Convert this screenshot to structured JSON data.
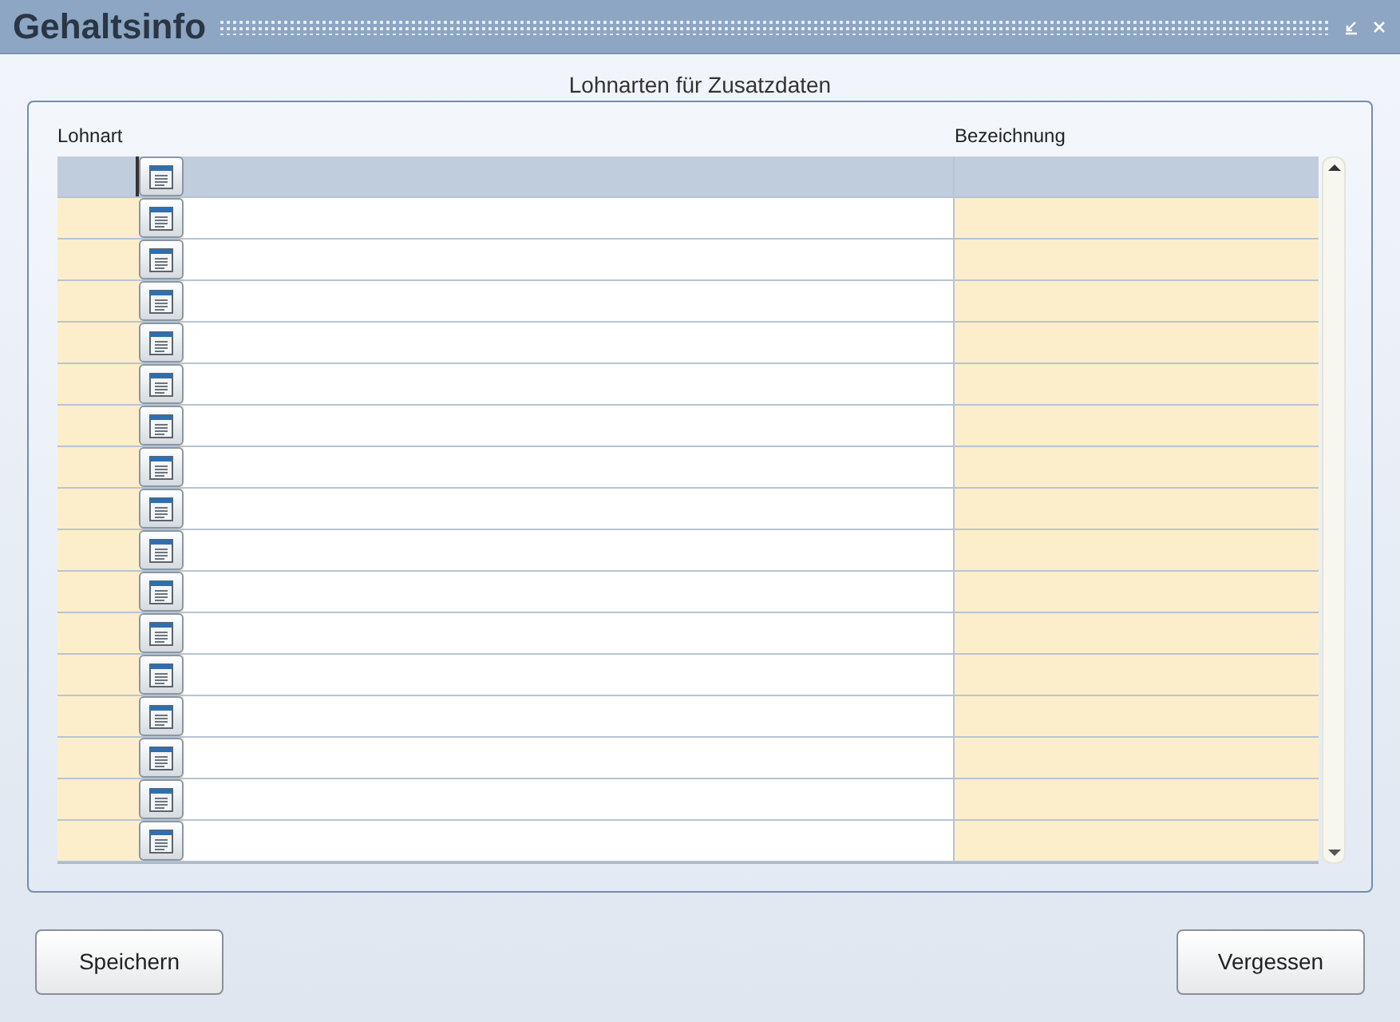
{
  "window": {
    "title": "Gehaltsinfo"
  },
  "section": {
    "title": "Lohnarten für Zusatzdaten"
  },
  "table": {
    "columns": [
      "Lohnart",
      "Bezeichnung"
    ],
    "rows": [
      {
        "selected": true
      },
      {
        "selected": false
      },
      {
        "selected": false
      },
      {
        "selected": false
      },
      {
        "selected": false
      },
      {
        "selected": false
      },
      {
        "selected": false
      },
      {
        "selected": false
      },
      {
        "selected": false
      },
      {
        "selected": false
      },
      {
        "selected": false
      },
      {
        "selected": false
      },
      {
        "selected": false
      },
      {
        "selected": false
      },
      {
        "selected": false
      },
      {
        "selected": false
      },
      {
        "selected": false
      }
    ]
  },
  "buttons": [
    "Speichern",
    "Vergessen"
  ]
}
